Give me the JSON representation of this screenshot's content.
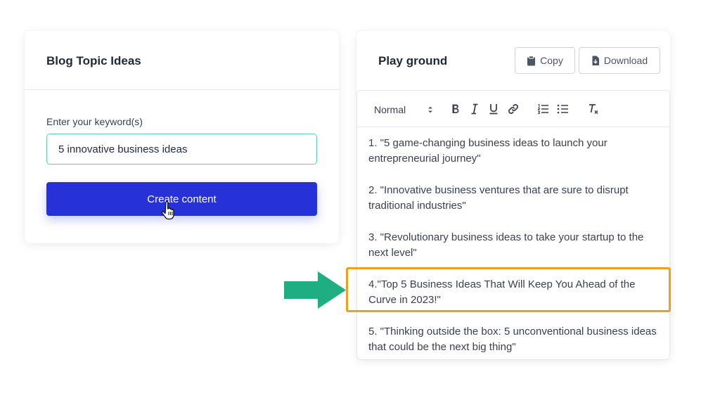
{
  "left_card": {
    "title": "Blog Topic Ideas",
    "keyword_label": "Enter your keyword(s)",
    "keyword_value": "5 innovative business ideas",
    "create_button": "Create content"
  },
  "right_card": {
    "title": "Play ground",
    "copy_label": "Copy",
    "download_label": "Download",
    "toolbar": {
      "format_value": "Normal"
    },
    "items": [
      "1. \"5 game-changing business ideas to launch your entrepreneurial journey\"",
      "2. \"Innovative business ventures that are sure to disrupt traditional industries\"",
      "3. \"Revolutionary business ideas to take your startup to the next level\"",
      "4.\"Top 5 Business Ideas That Will Keep You Ahead of the Curve in 2023!\"",
      "5. \"Thinking outside the box: 5 unconventional business ideas that could be the next big thing\""
    ]
  },
  "colors": {
    "primary_button": "#2632d8",
    "input_border": "#5ccfb0",
    "highlight_border": "#f0a01e",
    "arrow": "#1fae82"
  },
  "icons": [
    "clipboard-icon",
    "download-file-icon",
    "select-arrows-icon",
    "bold-icon",
    "italic-icon",
    "underline-icon",
    "link-icon",
    "ordered-list-icon",
    "bullet-list-icon",
    "clear-format-icon",
    "hand-cursor-icon",
    "right-arrow-icon"
  ]
}
